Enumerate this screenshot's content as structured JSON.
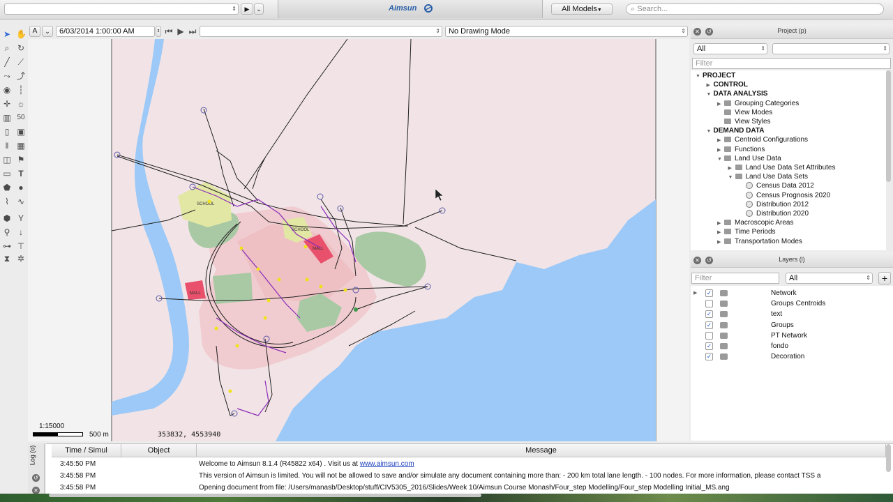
{
  "topbar": {
    "models_label": "All Models",
    "search_placeholder": "Search...",
    "logo_text": "Aimsun"
  },
  "viewbar": {
    "mode_letter": "A",
    "datetime": "6/03/2014 1:00:00 AM",
    "drawing_mode": "No Drawing Mode"
  },
  "map": {
    "labels": {
      "school1": "SCHOOL",
      "school2": "SCHOOL",
      "mall1": "MALL",
      "mall2": "MALL"
    },
    "scale_ratio": "1:15000",
    "scale_dist": "500 m",
    "coordinates": "353832, 4553940"
  },
  "project_panel": {
    "title": "Project (p)",
    "filter_type": "All",
    "filter_placeholder": "Filter",
    "tree": [
      {
        "label": "PROJECT",
        "level": 0,
        "expanded": true,
        "bold": true,
        "icon": "none"
      },
      {
        "label": "CONTROL",
        "level": 1,
        "expanded": false,
        "bold": true,
        "icon": "none"
      },
      {
        "label": "DATA ANALYSIS",
        "level": 1,
        "expanded": true,
        "bold": true,
        "icon": "none"
      },
      {
        "label": "Grouping Categories",
        "level": 2,
        "expanded": false,
        "bold": false,
        "icon": "folder"
      },
      {
        "label": "View Modes",
        "level": 2,
        "expanded": null,
        "bold": false,
        "icon": "folder"
      },
      {
        "label": "View Styles",
        "level": 2,
        "expanded": null,
        "bold": false,
        "icon": "folder"
      },
      {
        "label": "DEMAND DATA",
        "level": 1,
        "expanded": true,
        "bold": true,
        "icon": "none"
      },
      {
        "label": "Centroid Configurations",
        "level": 2,
        "expanded": false,
        "bold": false,
        "icon": "folder"
      },
      {
        "label": "Functions",
        "level": 2,
        "expanded": false,
        "bold": false,
        "icon": "folder"
      },
      {
        "label": "Land Use Data",
        "level": 2,
        "expanded": true,
        "bold": false,
        "icon": "folder"
      },
      {
        "label": "Land Use Data Set Attributes",
        "level": 3,
        "expanded": false,
        "bold": false,
        "icon": "folder"
      },
      {
        "label": "Land Use Data Sets",
        "level": 3,
        "expanded": true,
        "bold": false,
        "icon": "folder"
      },
      {
        "label": "Census Data 2012",
        "level": 4,
        "expanded": null,
        "bold": false,
        "icon": "doc"
      },
      {
        "label": "Census Prognosis 2020",
        "level": 4,
        "expanded": null,
        "bold": false,
        "icon": "doc"
      },
      {
        "label": "Distribution 2012",
        "level": 4,
        "expanded": null,
        "bold": false,
        "icon": "doc"
      },
      {
        "label": "Distribution 2020",
        "level": 4,
        "expanded": null,
        "bold": false,
        "icon": "doc"
      },
      {
        "label": "Macroscopic Areas",
        "level": 2,
        "expanded": false,
        "bold": false,
        "icon": "folder"
      },
      {
        "label": "Time Periods",
        "level": 2,
        "expanded": false,
        "bold": false,
        "icon": "folder"
      },
      {
        "label": "Transportation Modes",
        "level": 2,
        "expanded": false,
        "bold": false,
        "icon": "folder"
      }
    ]
  },
  "layers_panel": {
    "title": "Layers (l)",
    "filter_placeholder": "Filter",
    "filter_type": "All",
    "layers": [
      {
        "label": "Network",
        "checked": true,
        "expandable": true
      },
      {
        "label": "Groups Centroids",
        "checked": false,
        "expandable": false
      },
      {
        "label": "text",
        "checked": true,
        "expandable": false
      },
      {
        "label": "Groups",
        "checked": true,
        "expandable": false
      },
      {
        "label": "PT Network",
        "checked": false,
        "expandable": false
      },
      {
        "label": "fondo",
        "checked": true,
        "expandable": false
      },
      {
        "label": "Decoration",
        "checked": true,
        "expandable": false
      }
    ]
  },
  "log": {
    "tab_label": "Log (o)",
    "columns": [
      "Time / Simul",
      "Object",
      "Message"
    ],
    "rows": [
      {
        "time": "3:45:50 PM",
        "object": "",
        "message": "Welcome to Aimsun 8.1.4 (R45822 x64) . Visit us at ",
        "link": "www.aimsun.com"
      },
      {
        "time": "3:45:58 PM",
        "object": "",
        "message": "This version of Aimsun is limited. You will not be allowed to save and/or simulate any document containing more than: - 200 km total lane length. - 100 nodes. For more information, please contact TSS a",
        "link": ""
      },
      {
        "time": "3:45:58 PM",
        "object": "",
        "message": "Opening document from file: /Users/manasb/Desktop/stuff/CIV5305_2016/Slides/Week 10/Aimsun Course Monash/Four_step Modelling/Four_step Modelling Initial_MS.ang",
        "link": ""
      }
    ]
  },
  "colors": {
    "sea": "#9cc9f7",
    "land": "#f2e4e6",
    "zone_pink": "#f0c8cb",
    "green_area": "#a9c9a4",
    "school": "#e2e7a4",
    "mall": "#e8506b",
    "road": "#1f1f1f",
    "transit": "#8a2bb8",
    "node": "#f0e21a"
  }
}
